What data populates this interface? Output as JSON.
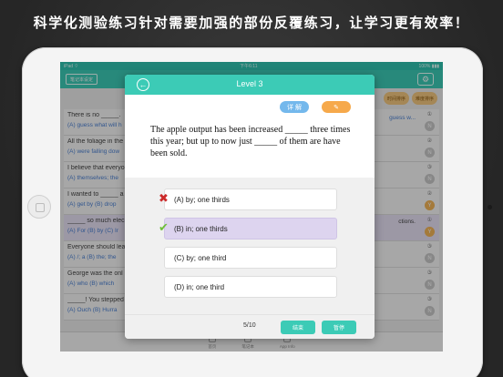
{
  "headline": "科学化测验练习针对需要加强的部份反覆练习，让学习更有效率！",
  "statusbar": {
    "left": "iPad ⌔",
    "center": "下午6:11",
    "right": "100% ▮▮▮"
  },
  "appbar": {
    "note_button": "笔记本设定",
    "settings_icon": "gear-icon"
  },
  "sort_buttons": [
    "时间排序",
    "难度排序"
  ],
  "list_rows": [
    {
      "question": "There is no _____.",
      "answer": "(A) guess what will h",
      "tail": "guess w...",
      "num": "①",
      "badge": "N",
      "yellow": false,
      "selected": false,
      "tail_dark": false
    },
    {
      "question": "All the foliage in the",
      "answer": "(A) were falling dow",
      "tail": "",
      "num": "②",
      "badge": "N",
      "yellow": false,
      "selected": false,
      "tail_dark": false
    },
    {
      "question": "I believe that everyo",
      "answer": "(A) themselves; the",
      "tail": "",
      "num": "③",
      "badge": "N",
      "yellow": false,
      "selected": false,
      "tail_dark": false
    },
    {
      "question": "I wanted to _____ a",
      "answer": "(A) get by   (B) drop",
      "tail": "",
      "num": "②",
      "badge": "Y",
      "yellow": true,
      "selected": false,
      "tail_dark": false
    },
    {
      "question": "_____ so much elec",
      "answer": "(A) For   (B) by   (C) Ir",
      "tail": "ctions.",
      "num": "①",
      "badge": "Y",
      "yellow": true,
      "selected": true,
      "tail_dark": true
    },
    {
      "question": "Everyone should lea",
      "answer": "(A) /; a   (B) the; the",
      "tail": "",
      "num": "③",
      "badge": "N",
      "yellow": false,
      "selected": false,
      "tail_dark": false
    },
    {
      "question": "George was the onl",
      "answer": "(A) who   (B) which",
      "tail": "",
      "num": "③",
      "badge": "N",
      "yellow": false,
      "selected": false,
      "tail_dark": false
    },
    {
      "question": "_____! You stepped",
      "answer": "(A) Ouch   (B) Hurra",
      "tail": "",
      "num": "③",
      "badge": "N",
      "yellow": false,
      "selected": false,
      "tail_dark": false
    }
  ],
  "tabs": [
    "首页",
    "笔记本",
    "App Info"
  ],
  "dialog": {
    "back_icon": "back-arrow-icon",
    "title": "Level 3",
    "detail_button": "详 解",
    "eraser_button": "✎",
    "question": "The apple output has been increased _____ three times this year; but up to now just _____ of them are have been sold.",
    "options": [
      {
        "label": "(A) by; one thirds",
        "state": "normal"
      },
      {
        "label": "(B) in; one thirds",
        "state": "wrong"
      },
      {
        "label": "(C) by; one third",
        "state": "correct"
      },
      {
        "label": "(D) in; one third",
        "state": "normal"
      }
    ],
    "progress": "5/10",
    "finish_button": "结束",
    "pause_button": "暂停"
  },
  "colors": {
    "accent": "#3ccbb6",
    "wrong_mark": "#cc2b2b",
    "correct_mark": "#6fbf3a",
    "wrong_fill": "#ddd4ef",
    "badge_yellow": "#f2b457"
  }
}
